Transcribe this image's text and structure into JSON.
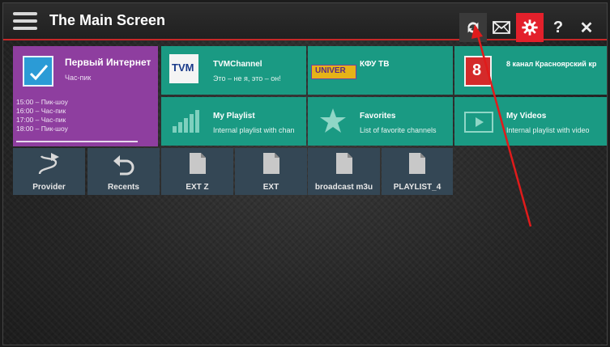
{
  "header": {
    "title": "The Main Screen",
    "accent_color": "#e3202b",
    "buttons": {
      "sync": "sync-icon",
      "mail": "mail-icon",
      "settings": "gear-icon",
      "help": "?",
      "close": "✕"
    }
  },
  "featured": {
    "channel_name": "Первый Интернет",
    "current_show": "Час-пик",
    "schedule": [
      "15:00 – Пик-шоу",
      "16:00 – Час-пик",
      "17:00 – Час-пик",
      "18:00 – Пик-шоу"
    ]
  },
  "channels": [
    {
      "name": "TVMChannel",
      "subtitle": "Это – не я, это – он!",
      "logo_text": "TVM"
    },
    {
      "name": "КФУ ТВ",
      "subtitle": "",
      "logo_text": "UNIVER"
    },
    {
      "name": "8 канал Красноярский кр",
      "subtitle": "",
      "logo_text": "8"
    }
  ],
  "lists": [
    {
      "name": "My Playlist",
      "subtitle": "Internal playlist with chan"
    },
    {
      "name": "Favorites",
      "subtitle": "List of favorite channels"
    },
    {
      "name": "My Videos",
      "subtitle": "Internal playlist with video"
    }
  ],
  "sources": [
    {
      "label": "Provider",
      "icon": "provider-icon"
    },
    {
      "label": "Recents",
      "icon": "undo-icon"
    },
    {
      "label": "EXT Z",
      "icon": "file-icon"
    },
    {
      "label": "EXT",
      "icon": "file-icon"
    },
    {
      "label": "broadcast m3u",
      "icon": "file-icon"
    },
    {
      "label": "PLAYLIST_4",
      "icon": "file-icon"
    }
  ]
}
